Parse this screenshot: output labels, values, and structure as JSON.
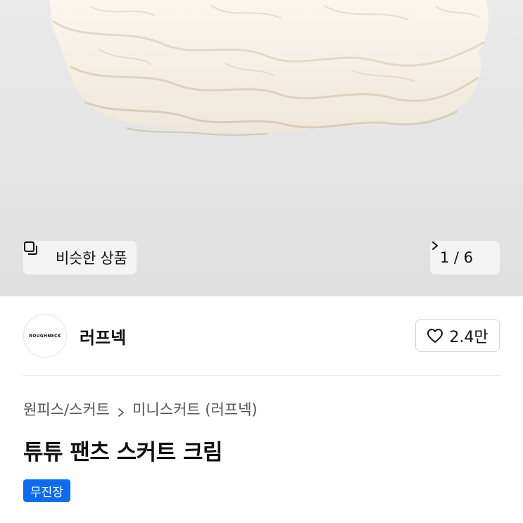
{
  "gallery": {
    "similar_label": "비슷한 상품",
    "similar_icon": "copy-icon",
    "page_indicator": "1 / 6",
    "next_icon": "chevron-right-icon"
  },
  "brand": {
    "logo_text": "ROUGHNECK",
    "name": "러프넥",
    "like_icon": "heart-icon",
    "like_count": "2.4만"
  },
  "breadcrumb": {
    "items": [
      "원피스/스커트",
      "미니스커트 (러프넥)"
    ],
    "separator_icon": "chevron-right-icon"
  },
  "product": {
    "title": "튜튜 팬츠 스커트 크림",
    "badge": "무진장"
  },
  "colors": {
    "badge_bg": "#0a6cf0",
    "hero_bg": "#e6e6e6"
  }
}
